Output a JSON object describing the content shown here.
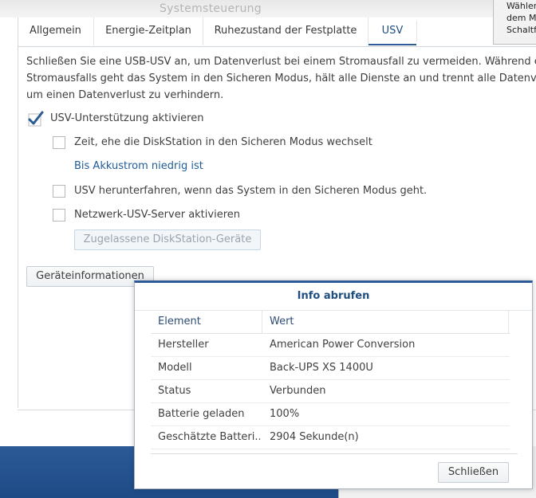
{
  "window": {
    "title": "Systemsteuerung"
  },
  "tooltip": {
    "lines": [
      "Wähler",
      "dem M",
      "Schaltf"
    ]
  },
  "tabs": [
    {
      "label": "Allgemein"
    },
    {
      "label": "Energie-Zeitplan"
    },
    {
      "label": "Ruhezustand der Festplatte"
    },
    {
      "label": "USV"
    }
  ],
  "description": {
    "line1": "Schließen Sie eine USB-USV an, um Datenverlust bei einem Stromausfall zu vermeiden. Während eines",
    "line2": "Stromausfalls geht das System in den Sicheren Modus, hält alle Dienste an und trennt alle Datenvolu",
    "line3": "um einen Datenverlust zu verhindern."
  },
  "options": {
    "enable_ups": {
      "label": "USV-Unterstützung aktivieren",
      "checked": true
    },
    "time_before_safe_mode": {
      "label": "Zeit, ehe die DiskStation in den Sicheren Modus wechselt",
      "checked": false
    },
    "battery_link": "Bis Akkustrom niedrig ist",
    "shutdown_ups": {
      "label": "USV herunterfahren, wenn das System in den Sicheren Modus geht.",
      "checked": false
    },
    "network_ups_server": {
      "label": "Netzwerk-USV-Server aktivieren",
      "checked": false
    },
    "permitted_devices_button": "Zugelassene DiskStation-Geräte"
  },
  "device_info_button": "Geräteinformationen",
  "dialog": {
    "title": "Info abrufen",
    "columns": {
      "element": "Element",
      "value": "Wert"
    },
    "rows": [
      {
        "element": "Hersteller",
        "value": "American Power Conversion"
      },
      {
        "element": "Modell",
        "value": "Back-UPS XS 1400U"
      },
      {
        "element": "Status",
        "value": "Verbunden"
      },
      {
        "element": "Batterie geladen",
        "value": "100%"
      },
      {
        "element": "Geschätzte Batteri...",
        "value": "2904 Sekunde(n)"
      }
    ],
    "close_button": "Schließen"
  },
  "colors": {
    "accent": "#2c5a97",
    "link": "#215d99",
    "check": "#2b5b93"
  }
}
